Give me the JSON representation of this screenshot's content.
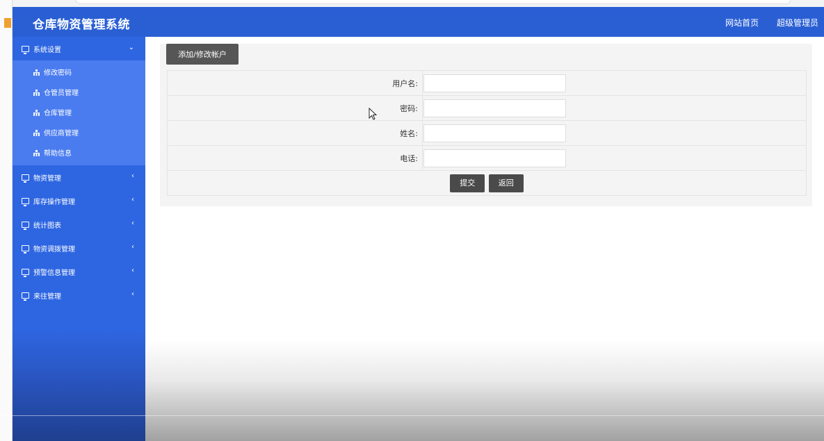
{
  "app": {
    "title": "仓库物资管理系统",
    "header_links": [
      "网站首页",
      "超级管理员"
    ]
  },
  "sidebar": {
    "sections": [
      {
        "label": "系统设置",
        "expanded": true,
        "arrow": "⌄",
        "children": [
          "修改密码",
          "仓管员管理",
          "仓库管理",
          "供应商管理",
          "帮助信息"
        ]
      },
      {
        "label": "物资管理",
        "expanded": false,
        "arrow": "‹"
      },
      {
        "label": "库存操作管理",
        "expanded": false,
        "arrow": "‹"
      },
      {
        "label": "统计图表",
        "expanded": false,
        "arrow": "‹"
      },
      {
        "label": "物资调拨管理",
        "expanded": false,
        "arrow": "‹"
      },
      {
        "label": "预警信息管理",
        "expanded": false,
        "arrow": "‹"
      },
      {
        "label": "来往管理",
        "expanded": false,
        "arrow": "‹"
      }
    ]
  },
  "main": {
    "tab_label": "添加/修改帐户",
    "form": {
      "fields": [
        {
          "label": "用户名:",
          "value": ""
        },
        {
          "label": "密码:",
          "value": ""
        },
        {
          "label": "姓名:",
          "value": ""
        },
        {
          "label": "电话:",
          "value": ""
        }
      ],
      "submit_label": "提交",
      "back_label": "返回"
    }
  },
  "colors": {
    "header": "#2a5fd4",
    "sidebar": "#2e66e2",
    "submenu": "#4a7cf0",
    "button": "#4a4a4a"
  },
  "icons": {
    "section": "monitor-icon",
    "submenu": "sitemap-icon",
    "cursor": "mouse-pointer-icon"
  }
}
